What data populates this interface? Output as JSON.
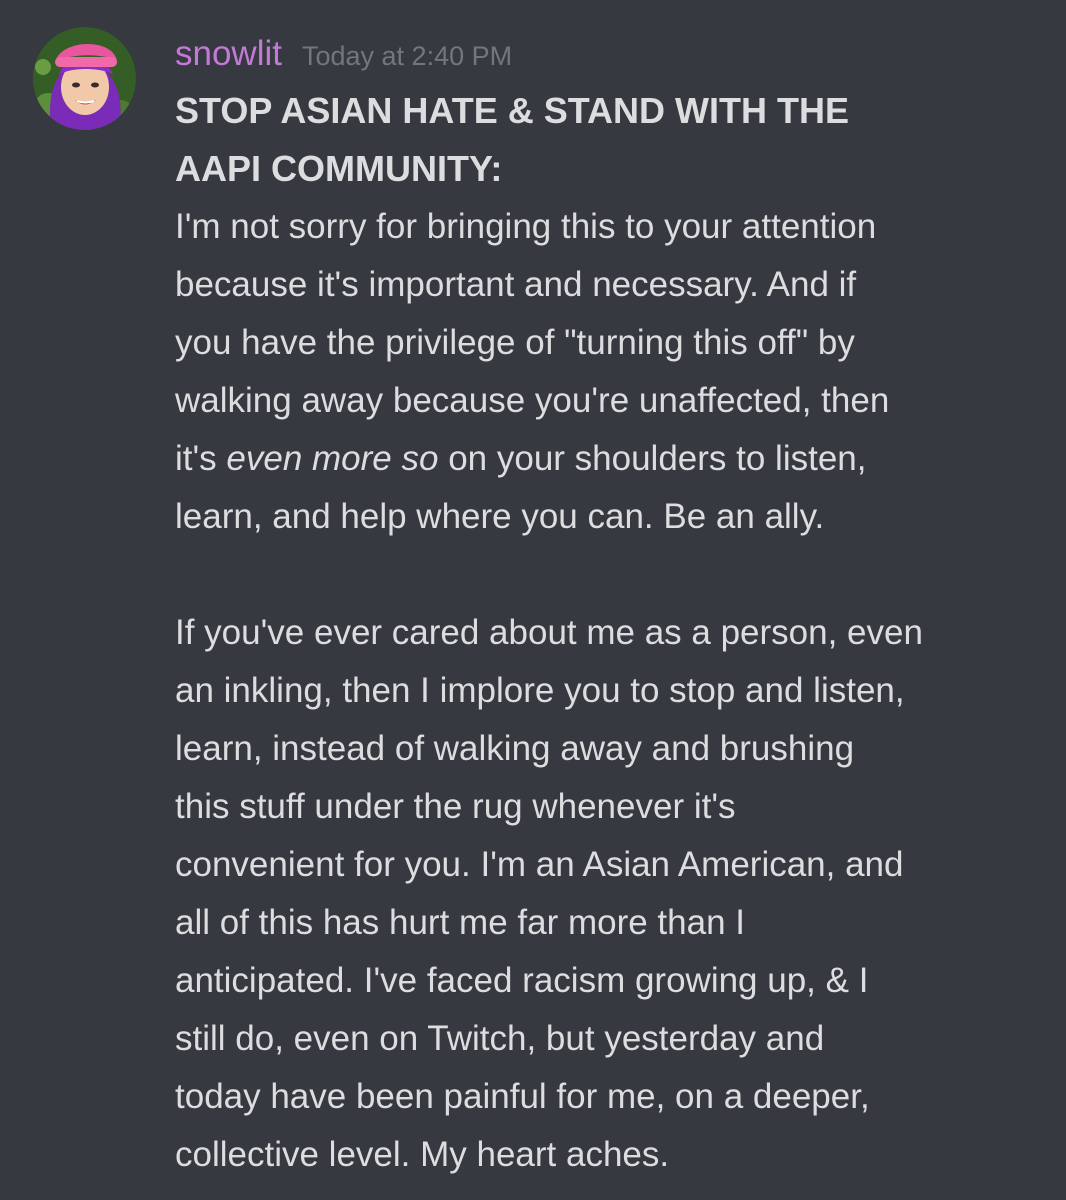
{
  "message": {
    "author": "snowlit",
    "timestamp": "Today at 2:40 PM",
    "avatar": {
      "icon": "user-avatar",
      "colors": {
        "hat": "#e9559e",
        "hair": "#8a2fc4",
        "background": "#3f6a2a",
        "skin": "#f1c9a8"
      }
    },
    "heading_lines": [
      "STOP ASIAN HATE & STAND WITH THE",
      "AAPI COMMUNITY:"
    ],
    "paragraph1": {
      "line1": "I'm not sorry for bringing this to your attention",
      "line2": "because it's important and necessary. And if",
      "line3": "you have the privilege of \"turning this off\" by",
      "line4": "walking away because you're unaffected, then",
      "line5_start": "it's ",
      "line5_emphasis": "even more so",
      "line5_end": " on your shoulders to listen,",
      "line6": "learn, and help where you can. Be an ally."
    },
    "paragraph2": [
      "If you've ever cared about me as a person, even",
      "an inkling, then I implore you to stop and listen,",
      "learn, instead of walking away and brushing",
      "this stuff under the rug whenever it's",
      "convenient for you. I'm an Asian American, and",
      "all of this has hurt me far more than I",
      "anticipated. I've faced racism growing up, & I",
      "still do, even on Twitch, but yesterday and",
      "today have been painful for me, on a deeper,",
      "collective level. My heart aches."
    ]
  }
}
